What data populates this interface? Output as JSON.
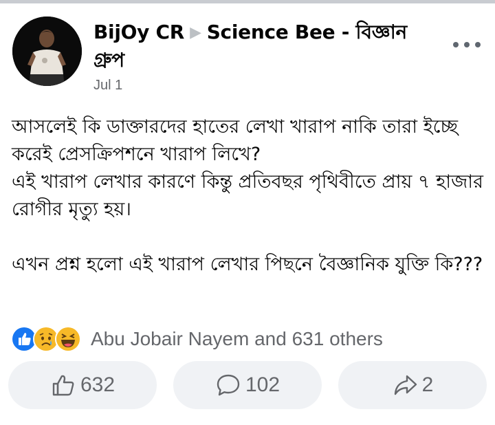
{
  "post": {
    "author": "BijOy CR",
    "separator_icon": "triangle-right-icon",
    "group": "Science Bee - বিজ্ঞান গ্রুপ",
    "date": "Jul 1",
    "text": "আসলেই কি ডাক্তারদের হাতের লেখা খারাপ নাকি তারা ইচ্ছে করেই প্রেসক্রিপশনে খারাপ লিখে?\nএই খারাপ লেখার কারণে কিন্তু প্রতিবছর পৃথিবীতে প্রায় ৭ হাজার রোগীর মৃত্যু হয়।\n\nএখন প্রশ্ন হলো এই খারাপ লেখার পিছনে বৈজ্ঞানিক যুক্তি কি???"
  },
  "reactions": {
    "icons": [
      "like-icon",
      "sad-icon",
      "haha-icon"
    ],
    "summary": "Abu Jobair Nayem and 631 others"
  },
  "actions": {
    "like_count": "632",
    "comment_count": "102",
    "share_count": "2"
  },
  "colors": {
    "secondary_text": "#65676b",
    "button_bg": "#f0f2f5",
    "like_blue": "#1877f2",
    "emoji_yellow": "#f7b928"
  }
}
